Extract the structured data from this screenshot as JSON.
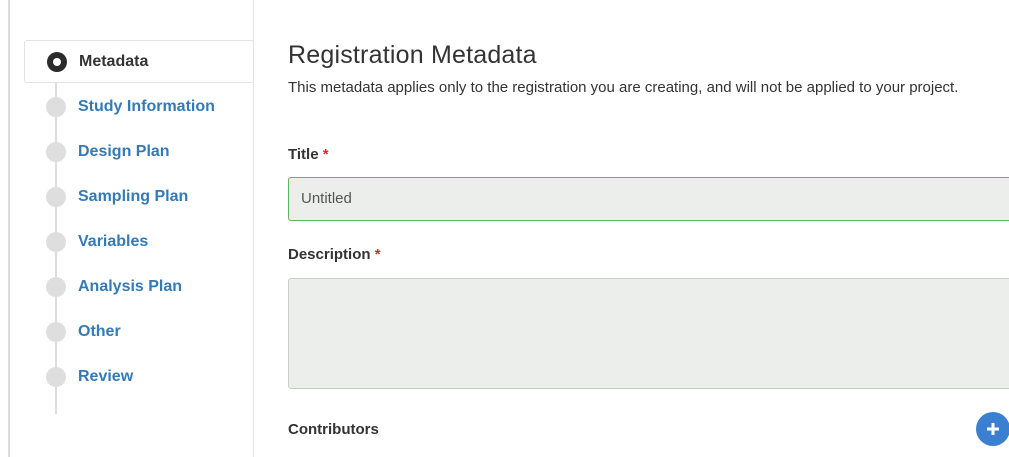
{
  "sidebar": {
    "steps": [
      {
        "label": "Metadata",
        "state": "active"
      },
      {
        "label": "Study Information",
        "state": "pending"
      },
      {
        "label": "Design Plan",
        "state": "pending"
      },
      {
        "label": "Sampling Plan",
        "state": "pending"
      },
      {
        "label": "Variables",
        "state": "pending"
      },
      {
        "label": "Analysis Plan",
        "state": "pending"
      },
      {
        "label": "Other",
        "state": "pending"
      },
      {
        "label": "Review",
        "state": "pending"
      }
    ]
  },
  "main": {
    "heading": "Registration Metadata",
    "intro": "This metadata applies only to the registration you are creating, and will not be applied to your project.",
    "title_field": {
      "label": "Title",
      "required_mark": "*",
      "value": "Untitled"
    },
    "description_field": {
      "label": "Description",
      "required_mark": "*",
      "value": ""
    },
    "contributors": {
      "label": "Contributors",
      "add_icon": "plus-icon"
    }
  },
  "colors": {
    "link": "#337ab7",
    "required": "#c9302c",
    "focus_border": "#5cb85c",
    "add_button": "#3b7fd0"
  }
}
